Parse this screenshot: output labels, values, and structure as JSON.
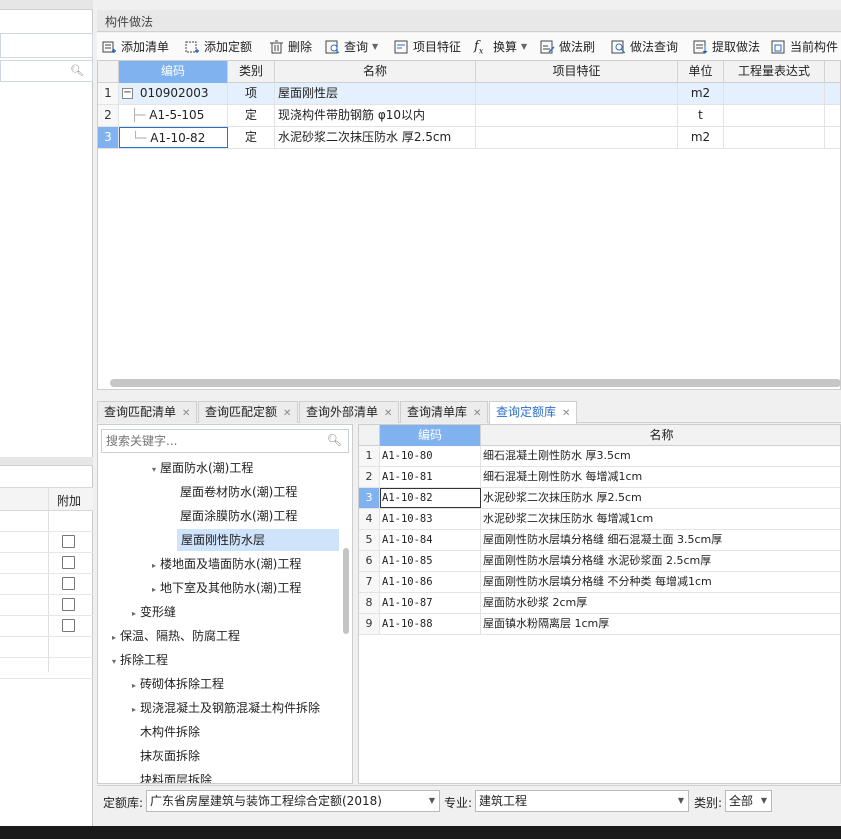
{
  "left_panel": {
    "col_header": "附加"
  },
  "component_panel": {
    "title": "构件做法",
    "toolbar": [
      {
        "label": "添加清单",
        "icon": "add-list-icon"
      },
      {
        "label": "添加定额",
        "icon": "add-quota-icon"
      },
      {
        "label": "删除",
        "icon": "delete-icon"
      },
      {
        "label": "查询",
        "icon": "query-icon",
        "dropdown": true
      },
      {
        "label": "项目特征",
        "icon": "feature-icon"
      },
      {
        "label": "换算",
        "icon": "fx-icon",
        "dropdown": true
      },
      {
        "label": "做法刷",
        "icon": "brush-icon"
      },
      {
        "label": "做法查询",
        "icon": "method-query-icon"
      },
      {
        "label": "提取做法",
        "icon": "extract-icon"
      },
      {
        "label": "当前构件",
        "icon": "current-component-icon"
      }
    ],
    "columns": [
      "编码",
      "类别",
      "名称",
      "项目特征",
      "单位",
      "工程量表达式"
    ],
    "rows": [
      {
        "num": "1",
        "code": "010902003",
        "type": "项",
        "name": "屋面刚性层",
        "feature": "",
        "unit": "m2",
        "expr": ""
      },
      {
        "num": "2",
        "code": "A1-5-105",
        "type": "定",
        "name": "现浇构件带肋钢筋 φ10以内",
        "feature": "",
        "unit": "t",
        "expr": ""
      },
      {
        "num": "3",
        "code": "A1-10-82",
        "type": "定",
        "name": "水泥砂浆二次抹压防水 厚2.5cm",
        "feature": "",
        "unit": "m2",
        "expr": ""
      }
    ],
    "collapse_sign": "−"
  },
  "tabs": [
    {
      "label": "查询匹配清单"
    },
    {
      "label": "查询匹配定额"
    },
    {
      "label": "查询外部清单"
    },
    {
      "label": "查询清单库"
    },
    {
      "label": "查询定额库",
      "active": true
    }
  ],
  "tree": {
    "search_placeholder": "搜索关键字...",
    "nodes": [
      {
        "label": "屋面防水(潮)工程",
        "arrow": "▾"
      },
      {
        "label": "屋面卷材防水(潮)工程",
        "arrow": ""
      },
      {
        "label": "屋面涂膜防水(潮)工程",
        "arrow": ""
      },
      {
        "label": "屋面刚性防水层",
        "arrow": "",
        "selected": true
      },
      {
        "label": "楼地面及墙面防水(潮)工程",
        "arrow": "▸"
      },
      {
        "label": "地下室及其他防水(潮)工程",
        "arrow": "▸"
      },
      {
        "label": "变形缝",
        "arrow": "▸"
      },
      {
        "label": "保温、隔热、防腐工程",
        "arrow": "▸"
      },
      {
        "label": "拆除工程",
        "arrow": "▾"
      },
      {
        "label": "砖砌体拆除工程",
        "arrow": "▸"
      },
      {
        "label": "现浇混凝土及钢筋混凝土构件拆除",
        "arrow": "▸"
      },
      {
        "label": "木构件拆除",
        "arrow": ""
      },
      {
        "label": "抹灰面拆除",
        "arrow": ""
      },
      {
        "label": "块料面层拆除",
        "arrow": ""
      }
    ]
  },
  "quota_grid": {
    "columns": [
      "编码",
      "名称"
    ],
    "rows": [
      {
        "num": "1",
        "code": "A1-10-80",
        "name": "细石混凝土刚性防水 厚3.5cm"
      },
      {
        "num": "2",
        "code": "A1-10-81",
        "name": "细石混凝土刚性防水 每增减1cm"
      },
      {
        "num": "3",
        "code": "A1-10-82",
        "name": "水泥砂浆二次抹压防水 厚2.5cm",
        "selected": true
      },
      {
        "num": "4",
        "code": "A1-10-83",
        "name": "水泥砂浆二次抹压防水 每增减1cm"
      },
      {
        "num": "5",
        "code": "A1-10-84",
        "name": "屋面刚性防水层填分格缝 细石混凝土面 3.5cm厚"
      },
      {
        "num": "6",
        "code": "A1-10-85",
        "name": "屋面刚性防水层填分格缝 水泥砂浆面 2.5cm厚"
      },
      {
        "num": "7",
        "code": "A1-10-86",
        "name": "屋面刚性防水层填分格缝 不分种类 每增减1cm"
      },
      {
        "num": "8",
        "code": "A1-10-87",
        "name": "屋面防水砂浆 2cm厚"
      },
      {
        "num": "9",
        "code": "A1-10-88",
        "name": "屋面镇水粉隔离层 1cm厚"
      }
    ]
  },
  "footer": {
    "quota_lib_label": "定额库:",
    "quota_lib_value": "广东省房屋建筑与装饰工程综合定额(2018)",
    "specialty_label": "专业:",
    "specialty_value": "建筑工程",
    "category_label": "类别:",
    "category_value": "全部"
  },
  "colors": {
    "selected_header": "#7fb2ee",
    "active_tab_text": "#2a6fc9",
    "tree_selected": "#cfe3fb"
  }
}
